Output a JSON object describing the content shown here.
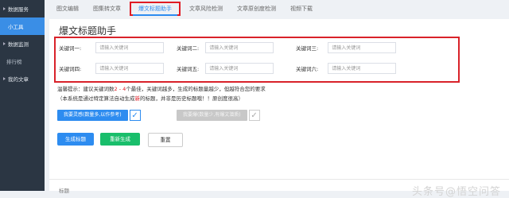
{
  "sidebar": {
    "items": [
      {
        "label": "数据服务",
        "active": false
      },
      {
        "label": "小工具",
        "active": true
      },
      {
        "label": "数据监测",
        "active": false
      },
      {
        "label": "排行榜",
        "active": false
      },
      {
        "label": "我的文章",
        "active": false
      }
    ]
  },
  "tabs": [
    {
      "label": "图文编辑",
      "active": false
    },
    {
      "label": "图集转文章",
      "active": false
    },
    {
      "label": "爆文标题助手",
      "active": true
    },
    {
      "label": "文章风险检测",
      "active": false
    },
    {
      "label": "文章原创度检测",
      "active": false
    },
    {
      "label": "视频下载",
      "active": false
    }
  ],
  "page": {
    "title": "爆文标题助手"
  },
  "keywords": [
    {
      "label": "关键词一:",
      "placeholder": "请输入关键词"
    },
    {
      "label": "关键词二:",
      "placeholder": "请输入关键词"
    },
    {
      "label": "关键词三:",
      "placeholder": "请输入关键词"
    },
    {
      "label": "关键词四:",
      "placeholder": "请输入关键词"
    },
    {
      "label": "关键词五:",
      "placeholder": "请输入关键词"
    },
    {
      "label": "关键词六:",
      "placeholder": "请输入关键词"
    }
  ],
  "tips": {
    "line1_a": "温馨提示：建议关键词数",
    "line1_b": "2 - 4",
    "line1_c": "个最佳，关键词越多，生成的标题量越少，但越符合您的要求",
    "line2_a": "（本系统是通过特定算法自动生成",
    "line2_b": "新",
    "line2_c": "的标题，并非是历史标题哦！！原创度很高）"
  },
  "options": [
    {
      "label": "我要灵感(数量多,以作参考)",
      "checked": true
    },
    {
      "label": "我要爆(数量少,有爆文潜质)",
      "checked": true
    }
  ],
  "buttons": {
    "generate": "生成标题",
    "regenerate": "重新生成",
    "reset": "重置"
  },
  "result": {
    "label": "标题"
  },
  "watermark": "头条号@悟空问答",
  "colors": {
    "primary": "#2d8cf0",
    "success": "#19be6b",
    "highlight": "#e01b24",
    "sidebar": "#2b3643"
  }
}
